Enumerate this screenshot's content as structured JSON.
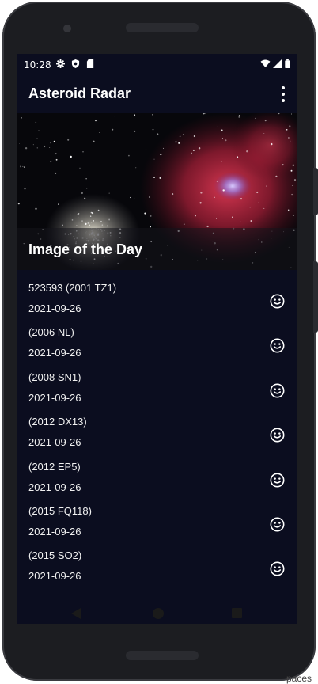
{
  "status_bar": {
    "time": "10:28",
    "left_icons": [
      "gear-icon",
      "shield-icon",
      "sd-card-icon"
    ],
    "right_icons": [
      "wifi-icon",
      "signal-icon",
      "battery-icon"
    ]
  },
  "app_bar": {
    "title": "Asteroid Radar",
    "menu_icon": "overflow-menu-icon"
  },
  "hero": {
    "title": "Image of the Day"
  },
  "asteroids": [
    {
      "name": "523593 (2001 TZ1)",
      "date": "2021-09-26",
      "status_icon": "smiley-face-icon"
    },
    {
      "name": "(2006 NL)",
      "date": "2021-09-26",
      "status_icon": "smiley-face-icon"
    },
    {
      "name": "(2008 SN1)",
      "date": "2021-09-26",
      "status_icon": "smiley-face-icon"
    },
    {
      "name": "(2012 DX13)",
      "date": "2021-09-26",
      "status_icon": "smiley-face-icon"
    },
    {
      "name": "(2012 EP5)",
      "date": "2021-09-26",
      "status_icon": "smiley-face-icon"
    },
    {
      "name": "(2015 FQ118)",
      "date": "2021-09-26",
      "status_icon": "smiley-face-icon"
    },
    {
      "name": "(2015 SO2)",
      "date": "2021-09-26",
      "status_icon": "smiley-face-icon"
    }
  ],
  "nav_bar": [
    "back-icon",
    "home-icon",
    "recents-icon"
  ],
  "background_fragment": "paces",
  "colors": {
    "screen_background": "#0b0d1f",
    "text": "#ffffff",
    "nebula": "#c0283c"
  }
}
